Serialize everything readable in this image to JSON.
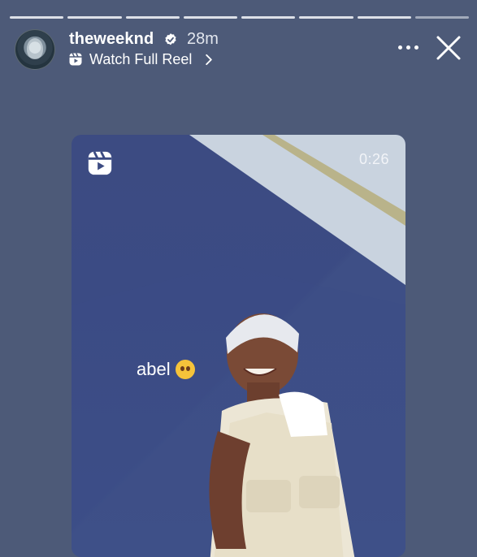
{
  "story": {
    "segments": 8,
    "active_segment": 8
  },
  "header": {
    "username": "theweeknd",
    "verified": true,
    "time_ago": "28m",
    "watch_label": "Watch Full Reel",
    "icons": {
      "reel": "reel-icon",
      "chevron": "chevron-right-icon",
      "more": "more-icon",
      "close": "close-icon"
    }
  },
  "video": {
    "duration": "0:26",
    "caption": "abel",
    "caption_emoji": "pleading-face-emoji"
  },
  "colors": {
    "background": "#4d5a78",
    "video_bg": "#3c4b82"
  }
}
